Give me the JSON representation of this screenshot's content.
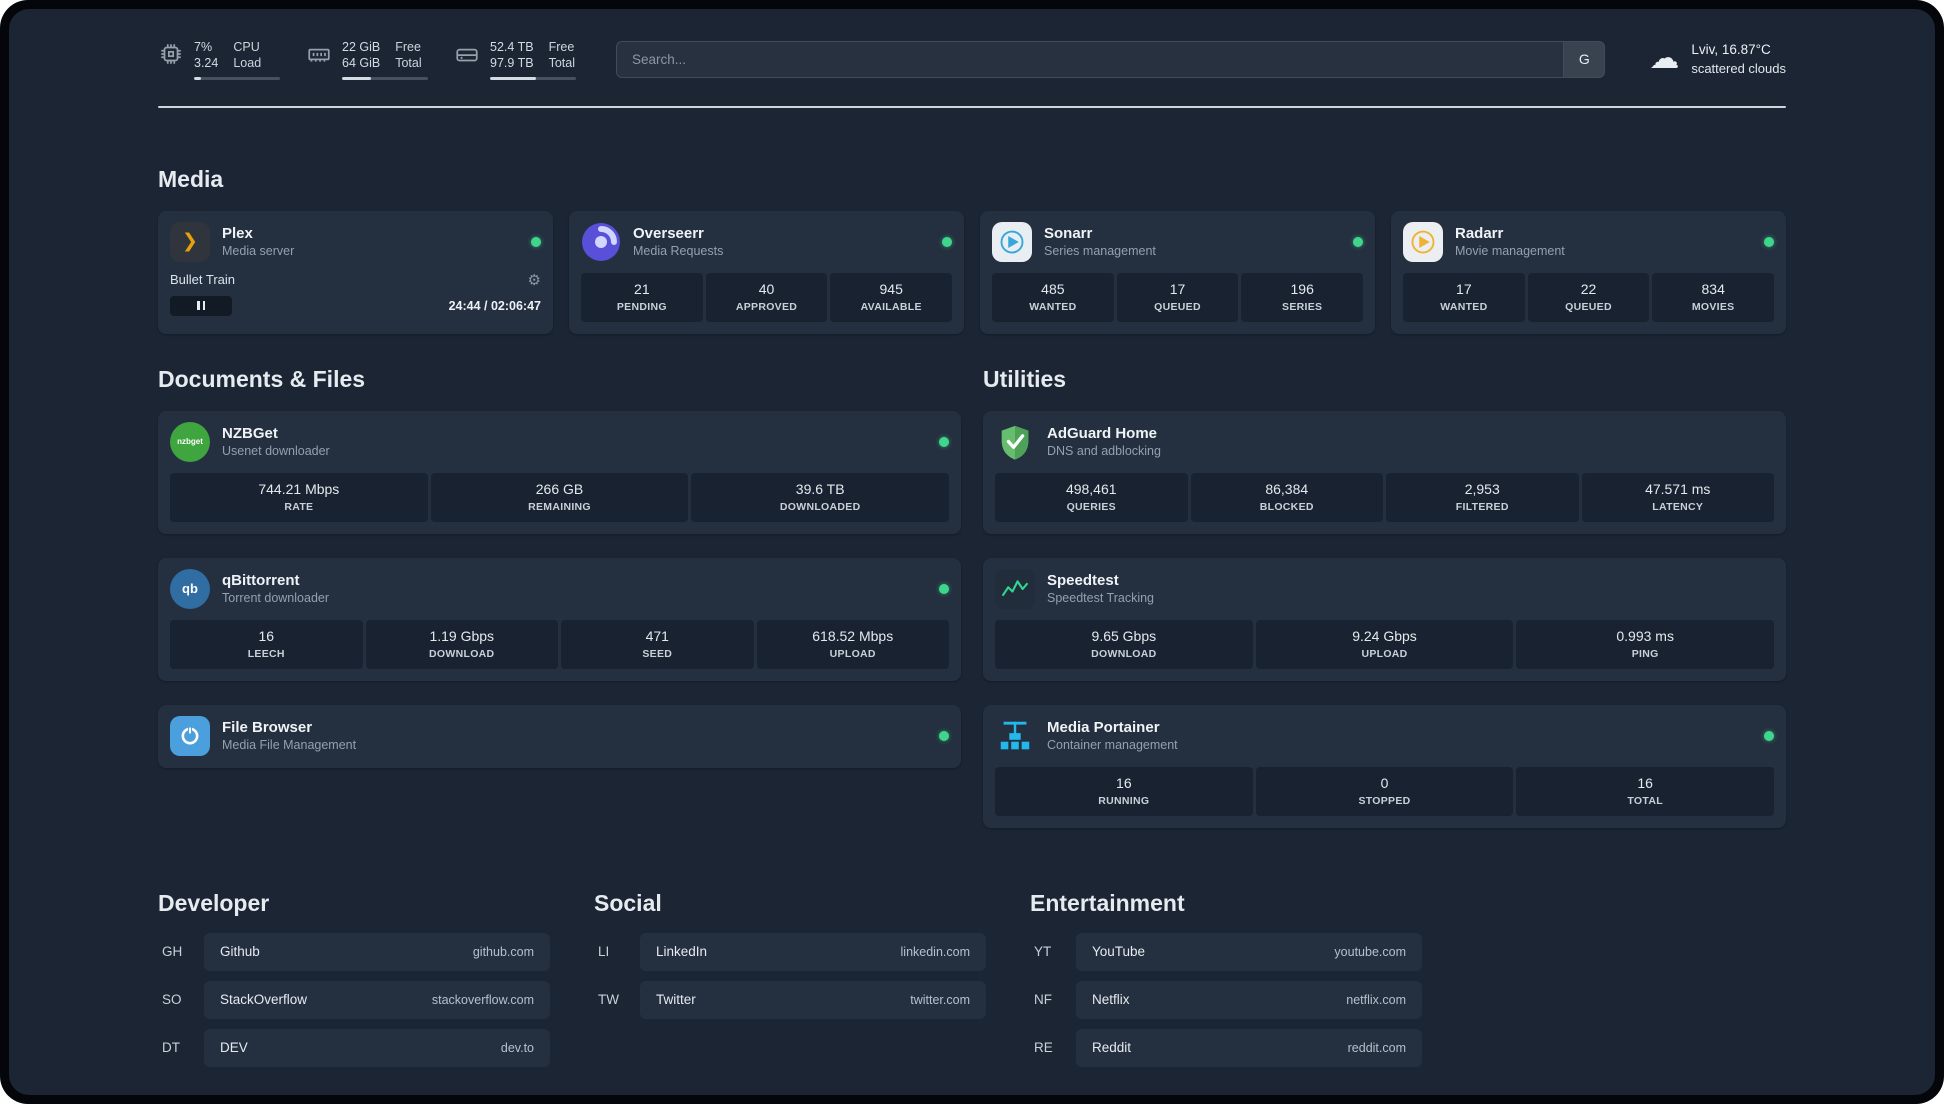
{
  "colors": {
    "background": "#1b2533",
    "card": "#242f40",
    "status_green": "#3fd68c",
    "accent_amber": "#e5a00d"
  },
  "topbar": {
    "cpu": {
      "value1": "7%",
      "value2": "3.24",
      "label1": "CPU",
      "label2": "Load"
    },
    "ram": {
      "value1": "22 GiB",
      "value2": "64 GiB",
      "label1": "Free",
      "label2": "Total"
    },
    "disk": {
      "value1": "52.4 TB",
      "value2": "97.9 TB",
      "label1": "Free",
      "label2": "Total"
    },
    "search": {
      "placeholder": "Search...",
      "button_label": "G"
    },
    "weather": {
      "location": "Lviv, 16.87°C",
      "condition": "scattered clouds"
    }
  },
  "sections": {
    "media": {
      "title": "Media",
      "plex": {
        "name": "Plex",
        "desc": "Media server",
        "track": "Bullet Train",
        "time": "24:44 / 02:06:47"
      },
      "overseerr": {
        "name": "Overseerr",
        "desc": "Media Requests",
        "stats": [
          {
            "value": "21",
            "label": "PENDING"
          },
          {
            "value": "40",
            "label": "APPROVED"
          },
          {
            "value": "945",
            "label": "AVAILABLE"
          }
        ]
      },
      "sonarr": {
        "name": "Sonarr",
        "desc": "Series management",
        "stats": [
          {
            "value": "485",
            "label": "WANTED"
          },
          {
            "value": "17",
            "label": "QUEUED"
          },
          {
            "value": "196",
            "label": "SERIES"
          }
        ]
      },
      "radarr": {
        "name": "Radarr",
        "desc": "Movie management",
        "stats": [
          {
            "value": "17",
            "label": "WANTED"
          },
          {
            "value": "22",
            "label": "QUEUED"
          },
          {
            "value": "834",
            "label": "MOVIES"
          }
        ]
      }
    },
    "documents": {
      "title": "Documents & Files",
      "nzbget": {
        "name": "NZBGet",
        "desc": "Usenet downloader",
        "icon_text": "nzbget",
        "stats": [
          {
            "value": "744.21 Mbps",
            "label": "RATE"
          },
          {
            "value": "266 GB",
            "label": "REMAINING"
          },
          {
            "value": "39.6 TB",
            "label": "DOWNLOADED"
          }
        ]
      },
      "qbittorrent": {
        "name": "qBittorrent",
        "desc": "Torrent downloader",
        "icon_text": "qb",
        "stats": [
          {
            "value": "16",
            "label": "LEECH"
          },
          {
            "value": "1.19 Gbps",
            "label": "DOWNLOAD"
          },
          {
            "value": "471",
            "label": "SEED"
          },
          {
            "value": "618.52 Mbps",
            "label": "UPLOAD"
          }
        ]
      },
      "filebrowser": {
        "name": "File Browser",
        "desc": "Media File Management"
      }
    },
    "utilities": {
      "title": "Utilities",
      "adguard": {
        "name": "AdGuard Home",
        "desc": "DNS and adblocking",
        "stats": [
          {
            "value": "498,461",
            "label": "QUERIES"
          },
          {
            "value": "86,384",
            "label": "BLOCKED"
          },
          {
            "value": "2,953",
            "label": "FILTERED"
          },
          {
            "value": "47.571 ms",
            "label": "LATENCY"
          }
        ]
      },
      "speedtest": {
        "name": "Speedtest",
        "desc": "Speedtest Tracking",
        "stats": [
          {
            "value": "9.65 Gbps",
            "label": "DOWNLOAD"
          },
          {
            "value": "9.24 Gbps",
            "label": "UPLOAD"
          },
          {
            "value": "0.993 ms",
            "label": "PING"
          }
        ]
      },
      "portainer": {
        "name": "Media Portainer",
        "desc": "Container management",
        "stats": [
          {
            "value": "16",
            "label": "RUNNING"
          },
          {
            "value": "0",
            "label": "STOPPED"
          },
          {
            "value": "16",
            "label": "TOTAL"
          }
        ]
      }
    }
  },
  "bookmarks": {
    "developer": {
      "title": "Developer",
      "items": [
        {
          "abbr": "GH",
          "name": "Github",
          "url": "github.com"
        },
        {
          "abbr": "SO",
          "name": "StackOverflow",
          "url": "stackoverflow.com"
        },
        {
          "abbr": "DT",
          "name": "DEV",
          "url": "dev.to"
        }
      ]
    },
    "social": {
      "title": "Social",
      "items": [
        {
          "abbr": "LI",
          "name": "LinkedIn",
          "url": "linkedin.com"
        },
        {
          "abbr": "TW",
          "name": "Twitter",
          "url": "twitter.com"
        }
      ]
    },
    "entertainment": {
      "title": "Entertainment",
      "items": [
        {
          "abbr": "YT",
          "name": "YouTube",
          "url": "youtube.com"
        },
        {
          "abbr": "NF",
          "name": "Netflix",
          "url": "netflix.com"
        },
        {
          "abbr": "RE",
          "name": "Reddit",
          "url": "reddit.com"
        }
      ]
    }
  }
}
